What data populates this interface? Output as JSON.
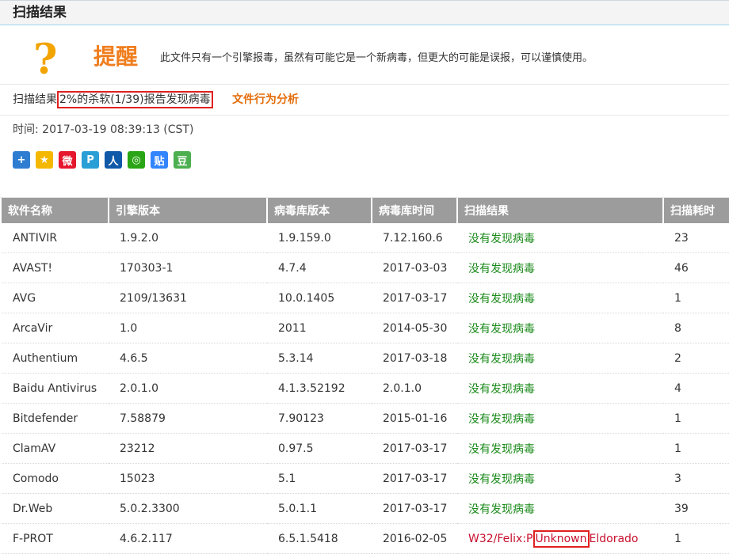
{
  "header": {
    "title": "扫描结果"
  },
  "alert": {
    "icon": "question-mark-icon",
    "title": "提醒",
    "message": "此文件只有一个引擎报毒，虽然有可能它是一个新病毒，但更大的可能是误报，可以谨慎使用。"
  },
  "summary": {
    "label": "扫描结果",
    "highlight": "2%的杀软(1/39)报告发现病毒",
    "behavior_link": "文件行为分析"
  },
  "time": {
    "text": "时间: 2017-03-19 08:39:13 (CST)"
  },
  "share_icons": [
    {
      "name": "share-plus-icon",
      "glyph": "+",
      "color": "#2e7dd1"
    },
    {
      "name": "qzone-icon",
      "glyph": "★",
      "color": "#f5b800"
    },
    {
      "name": "weibo-icon",
      "glyph": "微",
      "color": "#e6162d"
    },
    {
      "name": "tencent-weibo-icon",
      "glyph": "P",
      "color": "#2a9fd6"
    },
    {
      "name": "renren-icon",
      "glyph": "人",
      "color": "#1058a8"
    },
    {
      "name": "wechat-icon",
      "glyph": "◎",
      "color": "#2aa515"
    },
    {
      "name": "tieba-icon",
      "glyph": "贴",
      "color": "#3385ff"
    },
    {
      "name": "douban-icon",
      "glyph": "豆",
      "color": "#4caf50"
    }
  ],
  "table": {
    "columns": [
      "软件名称",
      "引擎版本",
      "病毒库版本",
      "病毒库时间",
      "扫描结果",
      "扫描耗时"
    ],
    "rows": [
      [
        "ANTIVIR",
        "1.9.2.0",
        "1.9.159.0",
        "7.12.160.6",
        "没有发现病毒",
        "23"
      ],
      [
        "AVAST!",
        "170303-1",
        "4.7.4",
        "2017-03-03",
        "没有发现病毒",
        "46"
      ],
      [
        "AVG",
        "2109/13631",
        "10.0.1405",
        "2017-03-17",
        "没有发现病毒",
        "1"
      ],
      [
        "ArcaVir",
        "1.0",
        "2011",
        "2014-05-30",
        "没有发现病毒",
        "8"
      ],
      [
        "Authentium",
        "4.6.5",
        "5.3.14",
        "2017-03-18",
        "没有发现病毒",
        "2"
      ],
      [
        "Baidu Antivirus",
        "2.0.1.0",
        "4.1.3.52192",
        "2.0.1.0",
        "没有发现病毒",
        "4"
      ],
      [
        "Bitdefender",
        "7.58879",
        "7.90123",
        "2015-01-16",
        "没有发现病毒",
        "1"
      ],
      [
        "ClamAV",
        "23212",
        "0.97.5",
        "2017-03-17",
        "没有发现病毒",
        "1"
      ],
      [
        "Comodo",
        "15023",
        "5.1",
        "2017-03-17",
        "没有发现病毒",
        "3"
      ],
      [
        "Dr.Web",
        "5.0.2.3300",
        "5.0.1.1",
        "2017-03-17",
        "没有发现病毒",
        "39"
      ]
    ],
    "detected_row": {
      "name": "F-PROT",
      "engine": "4.6.2.117",
      "db_version": "6.5.1.5418",
      "db_time": "2016-02-05",
      "result_prefix": "W32/Felix:P",
      "result_highlight": "Unknown",
      "result_suffix": "Eldorado",
      "time": "1"
    }
  },
  "colors": {
    "clean": "#1a8a1a",
    "detected": "#c8102e",
    "accent": "#f07e1e",
    "header_bg": "#9c9c9c"
  }
}
